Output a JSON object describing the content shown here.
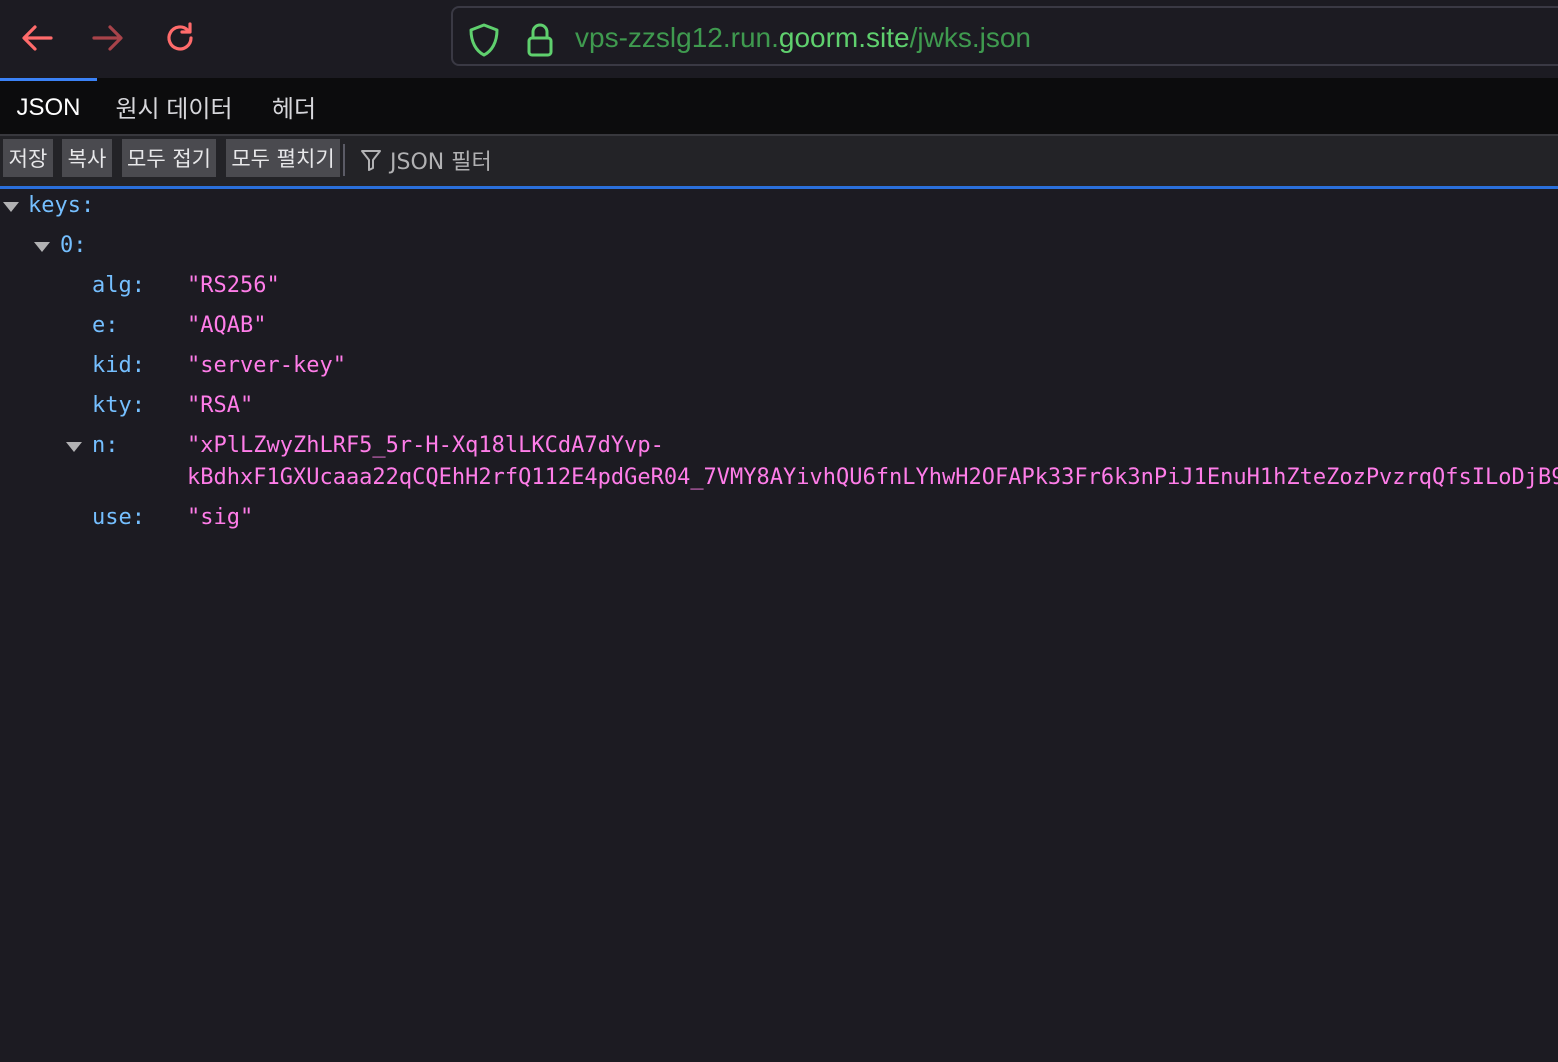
{
  "browser": {
    "url_scheme_host_prefix": "vps-zzslg12.run.",
    "url_host": "goorm.site",
    "url_path": "/jwks.json"
  },
  "tabs": [
    {
      "label": "JSON",
      "selected": true
    },
    {
      "label": "원시 데이터",
      "selected": false
    },
    {
      "label": "헤더",
      "selected": false
    }
  ],
  "actions": {
    "save": "저장",
    "copy": "복사",
    "collapse_all": "모두 접기",
    "expand_all": "모두 펼치기",
    "filter_label": "JSON 필터"
  },
  "json_tree": {
    "root_key": "keys:",
    "index_key": "0:",
    "fields": [
      {
        "key": "alg:",
        "value": "\"RS256\""
      },
      {
        "key": "e:",
        "value": "\"AQAB\""
      },
      {
        "key": "kid:",
        "value": "\"server-key\""
      },
      {
        "key": "kty:",
        "value": "\"RSA\""
      },
      {
        "key": "n:",
        "value_line1": "\"xPlLZwyZhLRF5_5r-H-Xq18lLKCdA7dYvp-",
        "value_line2": "kBdhxF1GXUcaaa22qCQEhH2rfQ112E4pdGeR04_7VMY8AYivhQU6fnLYhwH2OFAPk33Fr6k3nPiJ1EnuH1hZteZozPvzrqQfsILoDjB9"
      },
      {
        "key": "use:",
        "value": "\"sig\""
      }
    ]
  },
  "colors": {
    "key": "#75bfff",
    "string": "#ff7de9",
    "url_host": "#5fd06e",
    "url_rest": "#3f9a4f",
    "back_arrow": "#ff6b6b",
    "forward_arrow": "#a8434a",
    "reload": "#ff6b6b",
    "selected_tab_indicator": "#3b82f6"
  }
}
